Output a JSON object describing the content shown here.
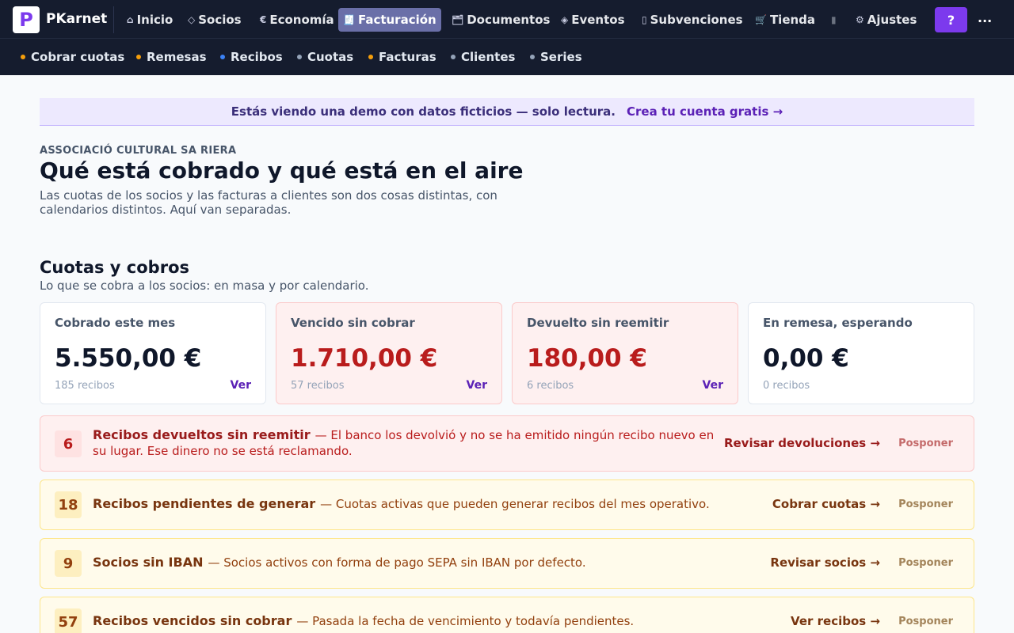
{
  "app": {
    "brand": "PKarnet",
    "logo_letter": "P"
  },
  "nav": {
    "items": [
      {
        "icon": "⌂",
        "icon_name": "home-icon",
        "label": "Inicio"
      },
      {
        "icon": "◇",
        "icon_name": "diamond-icon",
        "label": "Socios"
      },
      {
        "icon": "€",
        "icon_name": "euro-icon",
        "label": "Economía"
      },
      {
        "icon": "🧾",
        "icon_name": "receipt-icon",
        "label": "Facturación",
        "active": true
      },
      {
        "icon": "🗂",
        "icon_name": "folder-icon",
        "label": "Documentos"
      },
      {
        "icon": "◈",
        "icon_name": "event-diamond-icon",
        "label": "Eventos"
      },
      {
        "icon": "▯",
        "icon_name": "grant-icon",
        "label": "Subvenciones"
      },
      {
        "icon": "🛒",
        "icon_name": "cart-icon",
        "label": "Tienda"
      },
      {
        "icon": "▮",
        "icon_name": "overflow-icon",
        "label": ""
      },
      {
        "icon": "⚙",
        "icon_name": "gear-icon",
        "label": "Ajustes"
      }
    ],
    "help_label": "?",
    "more_label": "..."
  },
  "subnav": {
    "items": [
      {
        "label": "Cobrar cuotas",
        "dot": "#f59e0b"
      },
      {
        "label": "Remesas",
        "dot": "#f59e0b"
      },
      {
        "label": "Recibos",
        "dot": "#3b82f6"
      },
      {
        "label": "Cuotas",
        "dot": "#94a3b8"
      },
      {
        "label": "Facturas",
        "dot": "#f59e0b"
      },
      {
        "label": "Clientes",
        "dot": "#94a3b8"
      },
      {
        "label": "Series",
        "dot": "#94a3b8"
      }
    ]
  },
  "banner": {
    "text": "Estás viendo una demo con datos ficticios — solo lectura.",
    "link": "Crea tu cuenta gratis →"
  },
  "page": {
    "org": "ASSOCIACIÓ CULTURAL SA RIERA",
    "title": "Qué está cobrado y qué está en el aire",
    "intro": "Las cuotas de los socios y las facturas a clientes son dos cosas distintas, con calendarios distintos. Aquí van separadas."
  },
  "section": {
    "title": "Cuotas y cobros",
    "subtitle": "Lo que se cobra a los socios: en masa y por calendario."
  },
  "cards": [
    {
      "label": "Cobrado este mes",
      "value": "5.550,00 €",
      "foot": "185 recibos",
      "link": "Ver",
      "alert": false
    },
    {
      "label": "Vencido sin cobrar",
      "value": "1.710,00 €",
      "foot": "57 recibos",
      "link": "Ver",
      "alert": true
    },
    {
      "label": "Devuelto sin reemitir",
      "value": "180,00 €",
      "foot": "6 recibos",
      "link": "Ver",
      "alert": true
    },
    {
      "label": "En remesa, esperando",
      "value": "0,00 €",
      "foot": "0 recibos",
      "link": "",
      "alert": false
    }
  ],
  "tasks": [
    {
      "count": "6",
      "title": "Recibos devueltos sin reemitir",
      "desc": "— El banco los devolvió y no se ha emitido ningún recibo nuevo en su lugar. Ese dinero no se está reclamando.",
      "action": "Revisar devoluciones →",
      "postpone": "Posponer",
      "tone": "red"
    },
    {
      "count": "18",
      "title": "Recibos pendientes de generar",
      "desc": "— Cuotas activas que pueden generar recibos del mes operativo.",
      "action": "Cobrar cuotas →",
      "postpone": "Posponer",
      "tone": "yellow"
    },
    {
      "count": "9",
      "title": "Socios sin IBAN",
      "desc": "— Socios activos con forma de pago SEPA sin IBAN por defecto.",
      "action": "Revisar socios →",
      "postpone": "Posponer",
      "tone": "yellow"
    },
    {
      "count": "57",
      "title": "Recibos vencidos sin cobrar",
      "desc": "— Pasada la fecha de vencimiento y todavía pendientes.",
      "action": "Ver recibos →",
      "postpone": "Posponer",
      "tone": "yellow"
    }
  ]
}
